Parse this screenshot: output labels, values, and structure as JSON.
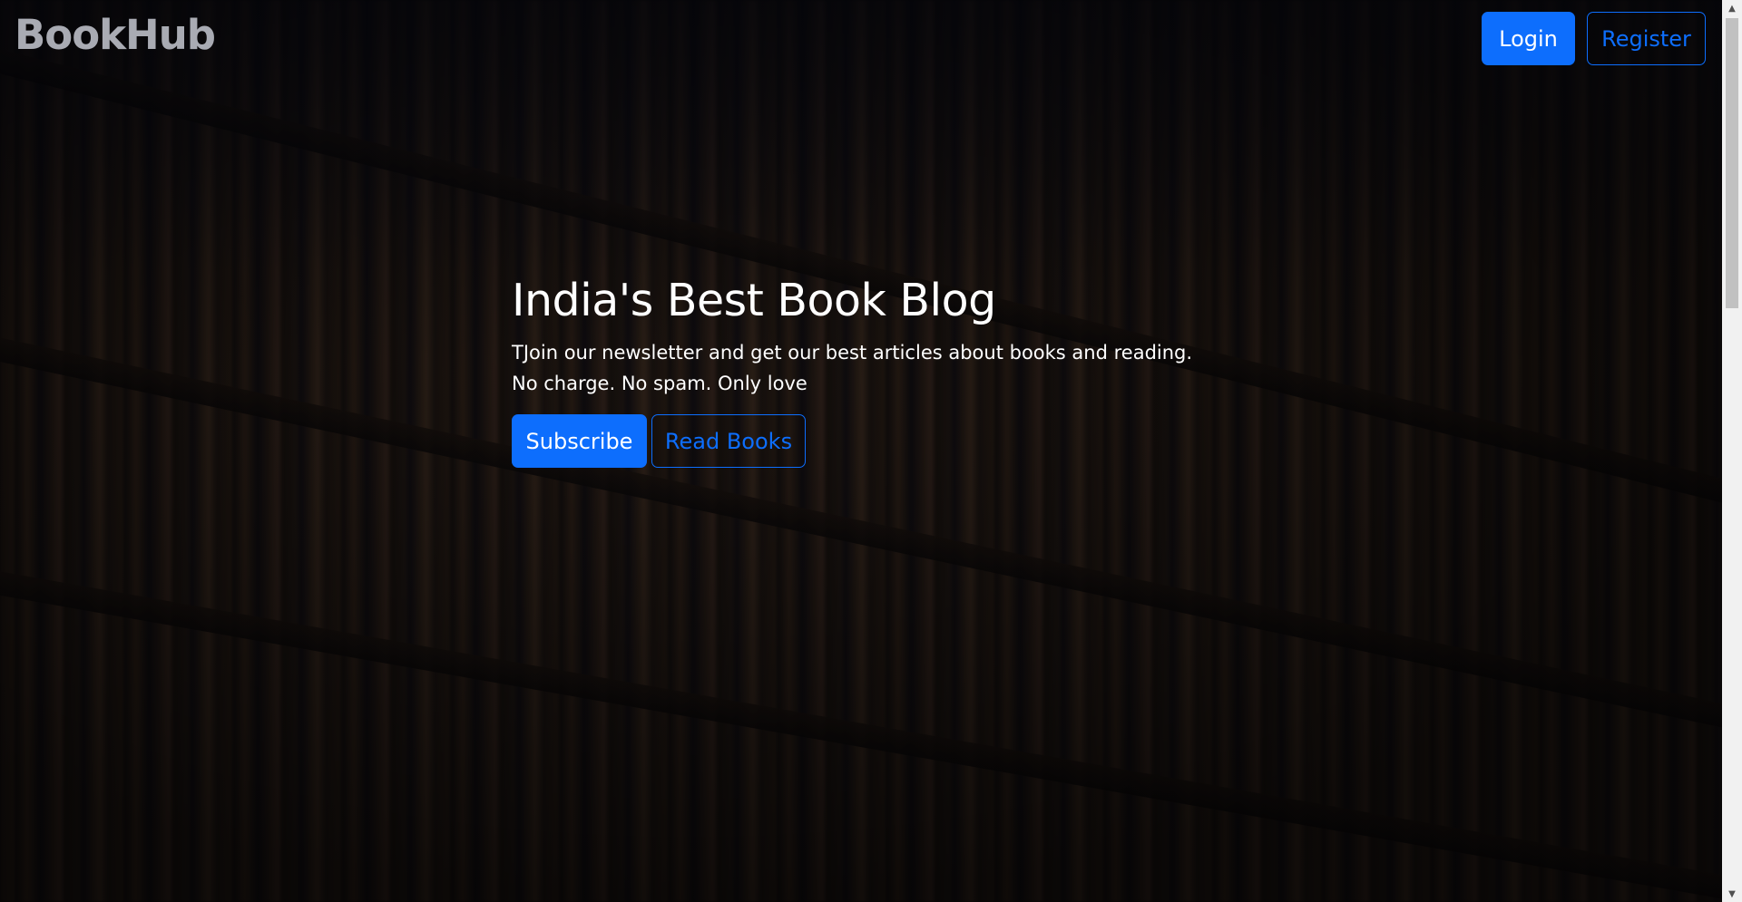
{
  "navbar": {
    "brand": "BookHub",
    "login_label": "Login",
    "register_label": "Register"
  },
  "hero": {
    "title": "India's Best Book Blog",
    "lead": "TJoin our newsletter and get our best articles about books and reading. No charge. No spam. Only love",
    "subscribe_label": "Subscribe",
    "read_books_label": "Read Books"
  },
  "icons": {
    "scroll_up": "scroll-up-icon",
    "scroll_down": "scroll-down-icon"
  },
  "colors": {
    "primary": "#0d6efd",
    "brand_text": "#a9abb3",
    "hero_text": "#ffffff"
  }
}
